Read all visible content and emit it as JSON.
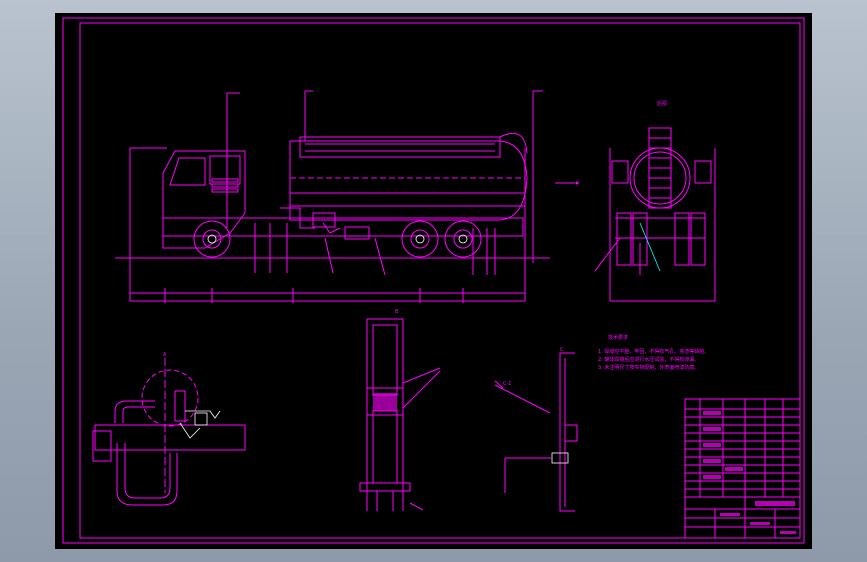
{
  "drawing": {
    "labels": {
      "rear_view_label": "后视",
      "section_a_label": "A",
      "section_b_label": "B",
      "section_c_label": "C",
      "detail_ref": "C-1",
      "notes_title": "技术要求",
      "note_1": "1. 焊缝应平整、牢固，不得有气孔、夹渣等缺陷。",
      "note_2": "2. 罐体焊接后应进行水压试验，不得有渗漏。",
      "note_3": "3. 未注明尺寸按实物配制，外表面喷漆防腐。"
    },
    "colors": {
      "line": "#ff00ff",
      "detail": "#ffffff",
      "leader": "#00ffff",
      "background": "#000000"
    }
  }
}
